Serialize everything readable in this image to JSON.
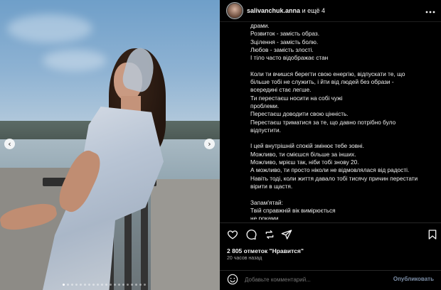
{
  "post": {
    "author": "salivanchuk.anna",
    "coauthors": "и ещё 4",
    "more_icon": "more-horizontal-icon",
    "caption_lines": [
      "драми.",
      "Розвиток - замість образ.",
      "Зцілення - замість болю.",
      "Любов - замість злості.",
      "І тіло часто відображає стан",
      "",
      "Коли ти вчишся берегти свою енергію, відпускати те, що",
      "більше тобі не служить, і йти від людей без образи -",
      "всередині стає легше.",
      "Ти перестаєш носити на собі чужі",
      "проблеми.",
      "Перестаєш доводити свою цінність.",
      "Перестаєш триматися за те, що давно потрібно було",
      "відпустити.",
      "",
      "І цей внутрішній спокій змінює тебе зовні.",
      "Можливо, ти смієшся більше за інших.",
      "Можливо, мрієш так, ніби тобі знову 20.",
      "А можливо, ти просто ніколи не відмовлялася від радості.",
      "Навіть тоді, коли життя давало тобі тисячу причин перестати",
      "вірити в щастя.",
      "",
      "Запам'ятай:",
      "Твій справжній вік вимірюється",
      "не роками"
    ],
    "likes": "2 805 отметок \"Нравится\"",
    "time": "20 часов назад"
  },
  "actions": {
    "like_icon": "heart-icon",
    "comment_icon": "comment-icon",
    "repost_icon": "repost-icon",
    "share_icon": "send-icon",
    "save_icon": "bookmark-icon"
  },
  "comment_box": {
    "emoji_icon": "emoji-icon",
    "placeholder": "Добавьте комментарий...",
    "publish_label": "Опубликовать"
  },
  "carousel": {
    "prev_icon": "chevron-left-icon",
    "next_icon": "chevron-right-icon",
    "prev_glyph": "‹",
    "next_glyph": "›",
    "total_slides": 20,
    "active_slide": 1
  }
}
